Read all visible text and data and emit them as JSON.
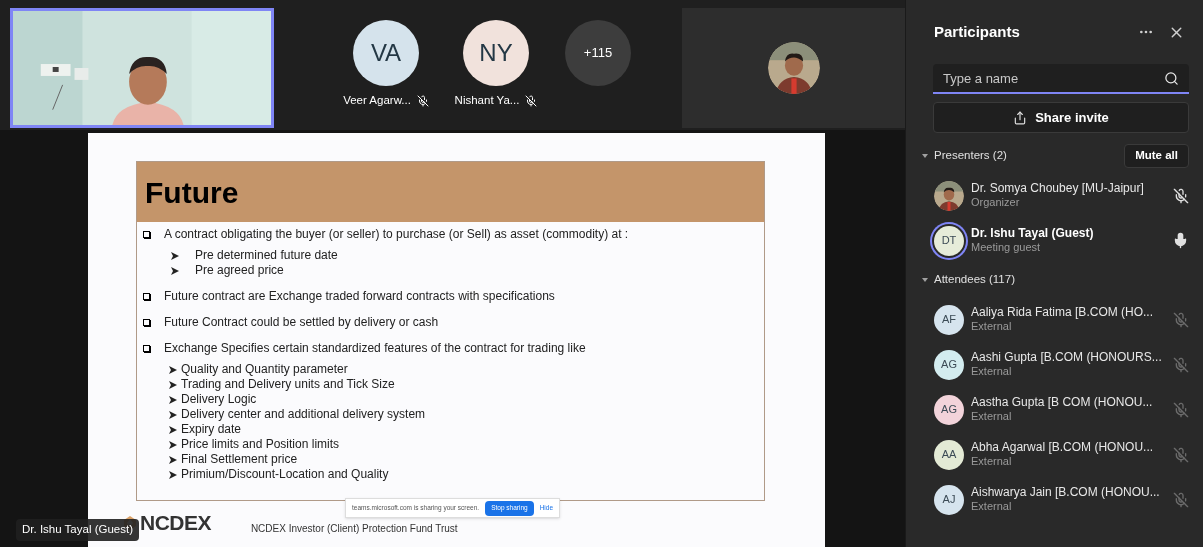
{
  "gallery": {
    "tiles": [
      {
        "initials": "VA",
        "name": "Veer Agarw...",
        "color": "#d5e3ec"
      },
      {
        "initials": "NY",
        "name": "Nishant Ya...",
        "color": "#f1e2dc"
      }
    ],
    "overflow": "+115"
  },
  "share": {
    "slide": {
      "title": "Future",
      "bullets": [
        {
          "text": "A contract obligating the buyer (or seller) to purchase (or Sell) as asset (commodity) at :",
          "children": [
            "Pre determined future date",
            "Pre agreed price"
          ]
        },
        {
          "text": "Future contract are Exchange traded forward contracts with specifications"
        },
        {
          "text": "Future Contract could be settled by delivery or cash"
        },
        {
          "text": "Exchange Specifies certain standardized features of the contract for trading like",
          "children": [
            "Quality and Quantity parameter",
            "Trading and Delivery units and Tick Size",
            "Delivery Logic",
            "Delivery center and additional delivery system",
            "Expiry date",
            "Price limits and Position limits",
            "Final Settlement price",
            "Primium/Discount-Location and Quality"
          ]
        }
      ],
      "logo": "NCDEX",
      "footer": "NCDEX Investor (Client) Protection Fund Trust"
    },
    "sharing_bar": {
      "text": "teams.microsoft.com is sharing your screen.",
      "stop": "Stop sharing",
      "hide": "Hide"
    },
    "presenter_tag": "Dr. Ishu Tayal (Guest)"
  },
  "panel": {
    "title": "Participants",
    "search": {
      "placeholder": "Type a name"
    },
    "share_invite": "Share invite",
    "sections": [
      {
        "label": "Presenters (2)",
        "expanded": true,
        "action": "Mute all",
        "people": [
          {
            "name": "Dr. Somya Choubey [MU-Jaipur]",
            "role": "Organizer",
            "muted": true,
            "dimmed": false,
            "speaking": false
          },
          {
            "name": "Dr. Ishu Tayal (Guest)",
            "role": "Meeting guest",
            "avatar": {
              "kind": "initials",
              "initials": "DT",
              "color": "#e6ecd9"
            },
            "muted": false,
            "dimmed": false,
            "speaking": true
          }
        ]
      },
      {
        "label": "Attendees (117)",
        "expanded": true,
        "people": [
          {
            "name": "Aaliya Rida Fatima [B.COM (HO...",
            "role": "External",
            "avatar": {
              "kind": "initials",
              "initials": "AF",
              "color": "#d6e4ee"
            },
            "muted": true,
            "dimmed": true,
            "speaking": false
          },
          {
            "name": "Aashi Gupta [B.COM (HONOURS...",
            "role": "External",
            "avatar": {
              "kind": "initials",
              "initials": "AG",
              "color": "#d3ecef"
            },
            "muted": true,
            "dimmed": true,
            "speaking": false
          },
          {
            "name": "Aastha Gupta [B COM (HONOU...",
            "role": "External",
            "avatar": {
              "kind": "initials",
              "initials": "AG",
              "color": "#f2d3da"
            },
            "muted": true,
            "dimmed": true,
            "speaking": false
          },
          {
            "name": "Abha Agarwal [B.COM (HONOU...",
            "role": "External",
            "avatar": {
              "kind": "initials",
              "initials": "AA",
              "color": "#e3ead5"
            },
            "muted": true,
            "dimmed": true,
            "speaking": false
          },
          {
            "name": "Aishwarya Jain [B.COM (HONOU...",
            "role": "External",
            "avatar": {
              "kind": "initials",
              "initials": "AJ",
              "color": "#d6e4ee"
            },
            "muted": true,
            "dimmed": true,
            "speaking": false
          }
        ]
      }
    ]
  }
}
